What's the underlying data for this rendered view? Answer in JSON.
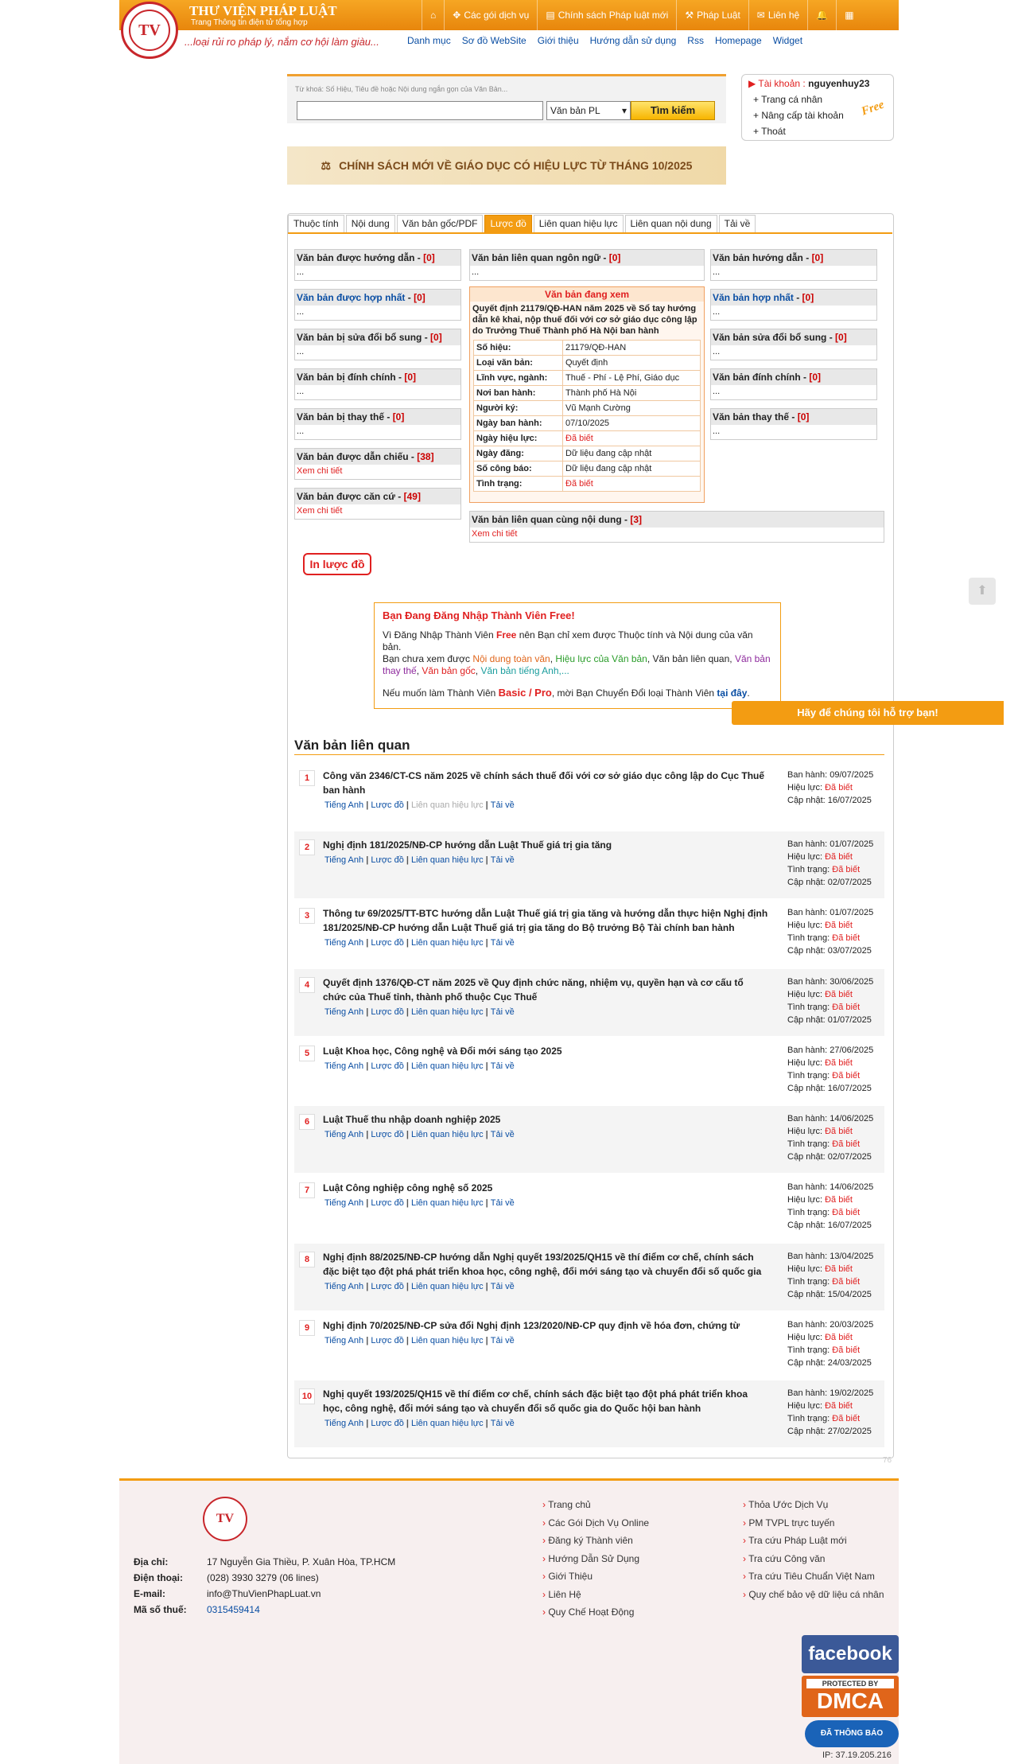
{
  "brand": {
    "title": "THƯ VIỆN PHÁP LUẬT",
    "subtitle": "Trang Thông tin điện tử tổng hợp",
    "slogan": "...loại rủi ro pháp lý, nắm cơ hội làm giàu...",
    "logo": "TV"
  },
  "nav": [
    {
      "label": "",
      "icon": "home-icon"
    },
    {
      "label": "Các gói dịch vụ",
      "icon": "package-icon"
    },
    {
      "label": "Chính sách Pháp luật mới",
      "icon": "newspaper-icon"
    },
    {
      "label": "Pháp Luật",
      "icon": "gavel-icon"
    },
    {
      "label": "Liên hệ",
      "icon": "mail-icon"
    },
    {
      "label": "",
      "icon": "bell-icon"
    },
    {
      "label": "",
      "icon": "uk-flag-icon"
    }
  ],
  "sublinks": [
    "Danh mục",
    "Sơ đồ WebSite",
    "Giới thiệu",
    "Hướng dẫn sử dụng",
    "Rss",
    "Homepage",
    "Widget"
  ],
  "search": {
    "hint": "Từ khoá: Số Hiệu, Tiêu đề hoặc Nội dung ngắn gọn của Văn Bản...",
    "value": "",
    "select": "Văn bản PL",
    "button": "Tìm kiếm"
  },
  "account": {
    "label": "Tài khoản :",
    "user": "nguyenhuy23",
    "items": [
      "Trang cá nhân",
      "Nâng cấp tài khoản",
      "Thoát"
    ],
    "badge": "Free"
  },
  "banner": "CHÍNH SÁCH MỚI VỀ GIÁO DỤC CÓ HIỆU LỰC TỪ THÁNG 10/2025",
  "tabs": [
    "Thuộc tính",
    "Nội dung",
    "Văn bản gốc/PDF",
    "Lược đồ",
    "Liên quan hiệu lực",
    "Liên quan nội dung",
    "Tải về"
  ],
  "left_boxes": [
    {
      "title": "Văn bản được hướng dẫn",
      "count": "[0]",
      "body": "...",
      "blue": false
    },
    {
      "title": "Văn bản được hợp nhất",
      "count": "[0]",
      "body": "...",
      "blue": true
    },
    {
      "title": "Văn bản bị sửa đổi bổ sung",
      "count": "[0]",
      "body": "...",
      "blue": false
    },
    {
      "title": "Văn bản bị đính chính",
      "count": "[0]",
      "body": "...",
      "blue": false
    },
    {
      "title": "Văn bản bị thay thế",
      "count": "[0]",
      "body": "...",
      "blue": false
    },
    {
      "title": "Văn bản được dẫn chiếu",
      "count": "[38]",
      "body": "Xem chi tiết",
      "blue": false
    },
    {
      "title": "Văn bản được căn cứ",
      "count": "[49]",
      "body": "Xem chi tiết",
      "blue": false
    }
  ],
  "right_boxes": [
    {
      "title": "Văn bản hướng dẫn",
      "count": "[0]",
      "body": "...",
      "blue": false
    },
    {
      "title": "Văn bản hợp nhất",
      "count": "[0]",
      "body": "...",
      "blue": true
    },
    {
      "title": "Văn bản sửa đổi bổ sung",
      "count": "[0]",
      "body": "...",
      "blue": false
    },
    {
      "title": "Văn bản đính chính",
      "count": "[0]",
      "body": "...",
      "blue": false
    },
    {
      "title": "Văn bản thay thế",
      "count": "[0]",
      "body": "...",
      "blue": false
    }
  ],
  "mid_top": {
    "title": "Văn bản liên quan ngôn ngữ",
    "count": "[0]",
    "body": "..."
  },
  "current": {
    "header": "Văn bản đang xem",
    "desc": "Quyết định 21179/QĐ-HAN năm 2025 về Sổ tay hướng dẫn kê khai, nộp thuế đối với cơ sở giáo dục công lập do Trưởng Thuế Thành phố Hà Nội ban hành",
    "props": [
      [
        "Số hiệu:",
        "21179/QĐ-HAN",
        false
      ],
      [
        "Loại văn bản:",
        "Quyết định",
        false
      ],
      [
        "Lĩnh vực, ngành:",
        "Thuế - Phí - Lệ Phí, Giáo dục",
        false
      ],
      [
        "Nơi ban hành:",
        "Thành phố Hà Nội",
        false
      ],
      [
        "Người ký:",
        "Vũ Mạnh Cường",
        false
      ],
      [
        "Ngày ban hành:",
        "07/10/2025",
        false
      ],
      [
        "Ngày hiệu lực:",
        "Đã biết",
        true
      ],
      [
        "Ngày đăng:",
        "Dữ liệu đang cập nhật",
        false
      ],
      [
        "Số công báo:",
        "Dữ liệu đang cập nhật",
        false
      ],
      [
        "Tình trạng:",
        "Đã biết",
        true
      ]
    ]
  },
  "mid_bottom": {
    "title": "Văn bản liên quan cùng nội dung",
    "count": "[3]",
    "body": "Xem chi tiết"
  },
  "print_button": "In lược đồ",
  "notice": {
    "title": "Bạn Đang Đăng Nhập Thành Viên Free!",
    "p1a": "Vì Đăng Nhập Thành Viên ",
    "p1b": "Free",
    "p1c": " nên Bạn chỉ xem được Thuộc tính và Nội dung của văn bản.",
    "p2a": "Bạn chưa xem được ",
    "p2b": "Nội dung toàn văn",
    "p2c": ", ",
    "p2d": "Hiệu lực của Văn bản",
    "p2e": ", Văn bản liên quan, ",
    "p2f": "Văn bản thay thế",
    "p2g": ", ",
    "p2h": "Văn bản gốc",
    "p2i": ", ",
    "p2j": "Văn bản tiếng Anh",
    "p2k": ",...",
    "p3a": "Nếu muốn làm Thành Viên ",
    "p3b": "Basic / Pro",
    "p3c": ", mời Bạn Chuyển Đổi loại Thành Viên ",
    "p3d": "tại đây",
    "p3e": "."
  },
  "help_button": "Hãy để chúng tôi hỗ trợ bạn!",
  "related_title": "Văn bản liên quan",
  "related": [
    {
      "n": "1",
      "title": "Công văn 2346/CT-CS năm 2025 về chính sách thuế đối với cơ sở giáo dục công lập do Cục Thuế ban hành",
      "links": [
        "Tiếng Anh",
        "Lược đồ",
        "Liên quan hiệu lực",
        "Tải về"
      ],
      "dis": [
        0,
        2
      ],
      "meta": [
        [
          "Ban hành:",
          "09/07/2025",
          false
        ],
        [
          "Hiệu lực:",
          "Đã biết",
          true
        ],
        [
          "Cập nhật:",
          "16/07/2025",
          false
        ]
      ]
    },
    {
      "n": "2",
      "title": "Nghị định 181/2025/NĐ-CP hướng dẫn Luật Thuế giá trị gia tăng",
      "links": [
        "Tiếng Anh",
        "Lược đồ",
        "Liên quan hiệu lực",
        "Tải về"
      ],
      "dis": [],
      "meta": [
        [
          "Ban hành:",
          "01/07/2025",
          false
        ],
        [
          "Hiệu lực:",
          "Đã biết",
          true
        ],
        [
          "Tình trạng:",
          "Đã biết",
          true
        ],
        [
          "Cập nhật:",
          "02/07/2025",
          false
        ]
      ]
    },
    {
      "n": "3",
      "title": "Thông tư 69/2025/TT-BTC hướng dẫn Luật Thuế giá trị gia tăng và hướng dẫn thực hiện Nghị định 181/2025/NĐ-CP hướng dẫn Luật Thuế giá trị gia tăng do Bộ trưởng Bộ Tài chính ban hành",
      "links": [
        "Tiếng Anh",
        "Lược đồ",
        "Liên quan hiệu lực",
        "Tải về"
      ],
      "dis": [],
      "meta": [
        [
          "Ban hành:",
          "01/07/2025",
          false
        ],
        [
          "Hiệu lực:",
          "Đã biết",
          true
        ],
        [
          "Tình trạng:",
          "Đã biết",
          true
        ],
        [
          "Cập nhật:",
          "03/07/2025",
          false
        ]
      ]
    },
    {
      "n": "4",
      "title": "Quyết định 1376/QĐ-CT năm 2025 về Quy định chức năng, nhiệm vụ, quyền hạn và cơ cấu tổ chức của Thuế tỉnh, thành phố thuộc Cục Thuế",
      "links": [
        "Tiếng Anh",
        "Lược đồ",
        "Liên quan hiệu lực",
        "Tải về"
      ],
      "dis": [],
      "meta": [
        [
          "Ban hành:",
          "30/06/2025",
          false
        ],
        [
          "Hiệu lực:",
          "Đã biết",
          true
        ],
        [
          "Tình trạng:",
          "Đã biết",
          true
        ],
        [
          "Cập nhật:",
          "01/07/2025",
          false
        ]
      ]
    },
    {
      "n": "5",
      "title": "Luật Khoa học, Công nghệ và Đổi mới sáng tạo 2025",
      "links": [
        "Tiếng Anh",
        "Lược đồ",
        "Liên quan hiệu lực",
        "Tải về"
      ],
      "dis": [],
      "meta": [
        [
          "Ban hành:",
          "27/06/2025",
          false
        ],
        [
          "Hiệu lực:",
          "Đã biết",
          true
        ],
        [
          "Tình trạng:",
          "Đã biết",
          true
        ],
        [
          "Cập nhật:",
          "16/07/2025",
          false
        ]
      ]
    },
    {
      "n": "6",
      "title": "Luật Thuế thu nhập doanh nghiệp 2025",
      "links": [
        "Tiếng Anh",
        "Lược đồ",
        "Liên quan hiệu lực",
        "Tải về"
      ],
      "dis": [],
      "meta": [
        [
          "Ban hành:",
          "14/06/2025",
          false
        ],
        [
          "Hiệu lực:",
          "Đã biết",
          true
        ],
        [
          "Tình trạng:",
          "Đã biết",
          true
        ],
        [
          "Cập nhật:",
          "02/07/2025",
          false
        ]
      ]
    },
    {
      "n": "7",
      "title": "Luật Công nghiệp công nghệ số 2025",
      "links": [
        "Tiếng Anh",
        "Lược đồ",
        "Liên quan hiệu lực",
        "Tải về"
      ],
      "dis": [],
      "meta": [
        [
          "Ban hành:",
          "14/06/2025",
          false
        ],
        [
          "Hiệu lực:",
          "Đã biết",
          true
        ],
        [
          "Tình trạng:",
          "Đã biết",
          true
        ],
        [
          "Cập nhật:",
          "16/07/2025",
          false
        ]
      ]
    },
    {
      "n": "8",
      "title": "Nghị định 88/2025/NĐ-CP hướng dẫn Nghị quyết 193/2025/QH15 về thí điểm cơ chế, chính sách đặc biệt tạo đột phá phát triển khoa học, công nghệ, đổi mới sáng tạo và chuyển đổi số quốc gia",
      "links": [
        "Tiếng Anh",
        "Lược đồ",
        "Liên quan hiệu lực",
        "Tải về"
      ],
      "dis": [],
      "meta": [
        [
          "Ban hành:",
          "13/04/2025",
          false
        ],
        [
          "Hiệu lực:",
          "Đã biết",
          true
        ],
        [
          "Tình trạng:",
          "Đã biết",
          true
        ],
        [
          "Cập nhật:",
          "15/04/2025",
          false
        ]
      ]
    },
    {
      "n": "9",
      "title": "Nghị định 70/2025/NĐ-CP sửa đổi Nghị định 123/2020/NĐ-CP quy định về hóa đơn, chứng từ",
      "links": [
        "Tiếng Anh",
        "Lược đồ",
        "Liên quan hiệu lực",
        "Tải về"
      ],
      "dis": [],
      "meta": [
        [
          "Ban hành:",
          "20/03/2025",
          false
        ],
        [
          "Hiệu lực:",
          "Đã biết",
          true
        ],
        [
          "Tình trạng:",
          "Đã biết",
          true
        ],
        [
          "Cập nhật:",
          "24/03/2025",
          false
        ]
      ]
    },
    {
      "n": "10",
      "title": "Nghị quyết 193/2025/QH15 về thí điểm cơ chế, chính sách đặc biệt tạo đột phá phát triển khoa học, công nghệ, đổi mới sáng tạo và chuyển đổi số quốc gia do Quốc hội ban hành",
      "links": [
        "Tiếng Anh",
        "Lược đồ",
        "Liên quan hiệu lực",
        "Tải về"
      ],
      "dis": [],
      "meta": [
        [
          "Ban hành:",
          "19/02/2025",
          false
        ],
        [
          "Hiệu lực:",
          "Đã biết",
          true
        ],
        [
          "Tình trạng:",
          "Đã biết",
          true
        ],
        [
          "Cập nhật:",
          "27/02/2025",
          false
        ]
      ]
    }
  ],
  "page_number": "76",
  "footer": {
    "logo": "TV",
    "contact": [
      [
        "Địa chỉ:",
        "17 Nguyễn Gia Thiều, P. Xuân Hòa, TP.HCM"
      ],
      [
        "Điện thoại:",
        "(028) 3930 3279 (06 lines)"
      ],
      [
        "E-mail:",
        "info@ThuVienPhapLuat.vn"
      ],
      [
        "Mã số thuế:",
        "0315459414"
      ]
    ],
    "col1": [
      "Trang chủ",
      "Các Gói Dịch Vụ Online",
      "Đăng ký Thành viên",
      "Hướng Dẫn Sử Dụng",
      "Giới Thiệu",
      "Liên Hệ",
      "Quy Chế Hoạt Động"
    ],
    "col2": [
      "Thỏa Ước Dịch Vụ",
      "PM TVPL trực tuyến",
      "Tra cứu Pháp Luật mới",
      "Tra cứu Công văn",
      "Tra cứu Tiêu Chuẩn Việt Nam",
      "Quy chế bảo vệ dữ liệu cá nhân"
    ],
    "facebook": "facebook",
    "dmca_top": "PROTECTED BY",
    "dmca": "DMCA",
    "bct": "ĐÃ THÔNG BÁO",
    "ip": "IP: 37.19.205.216"
  }
}
